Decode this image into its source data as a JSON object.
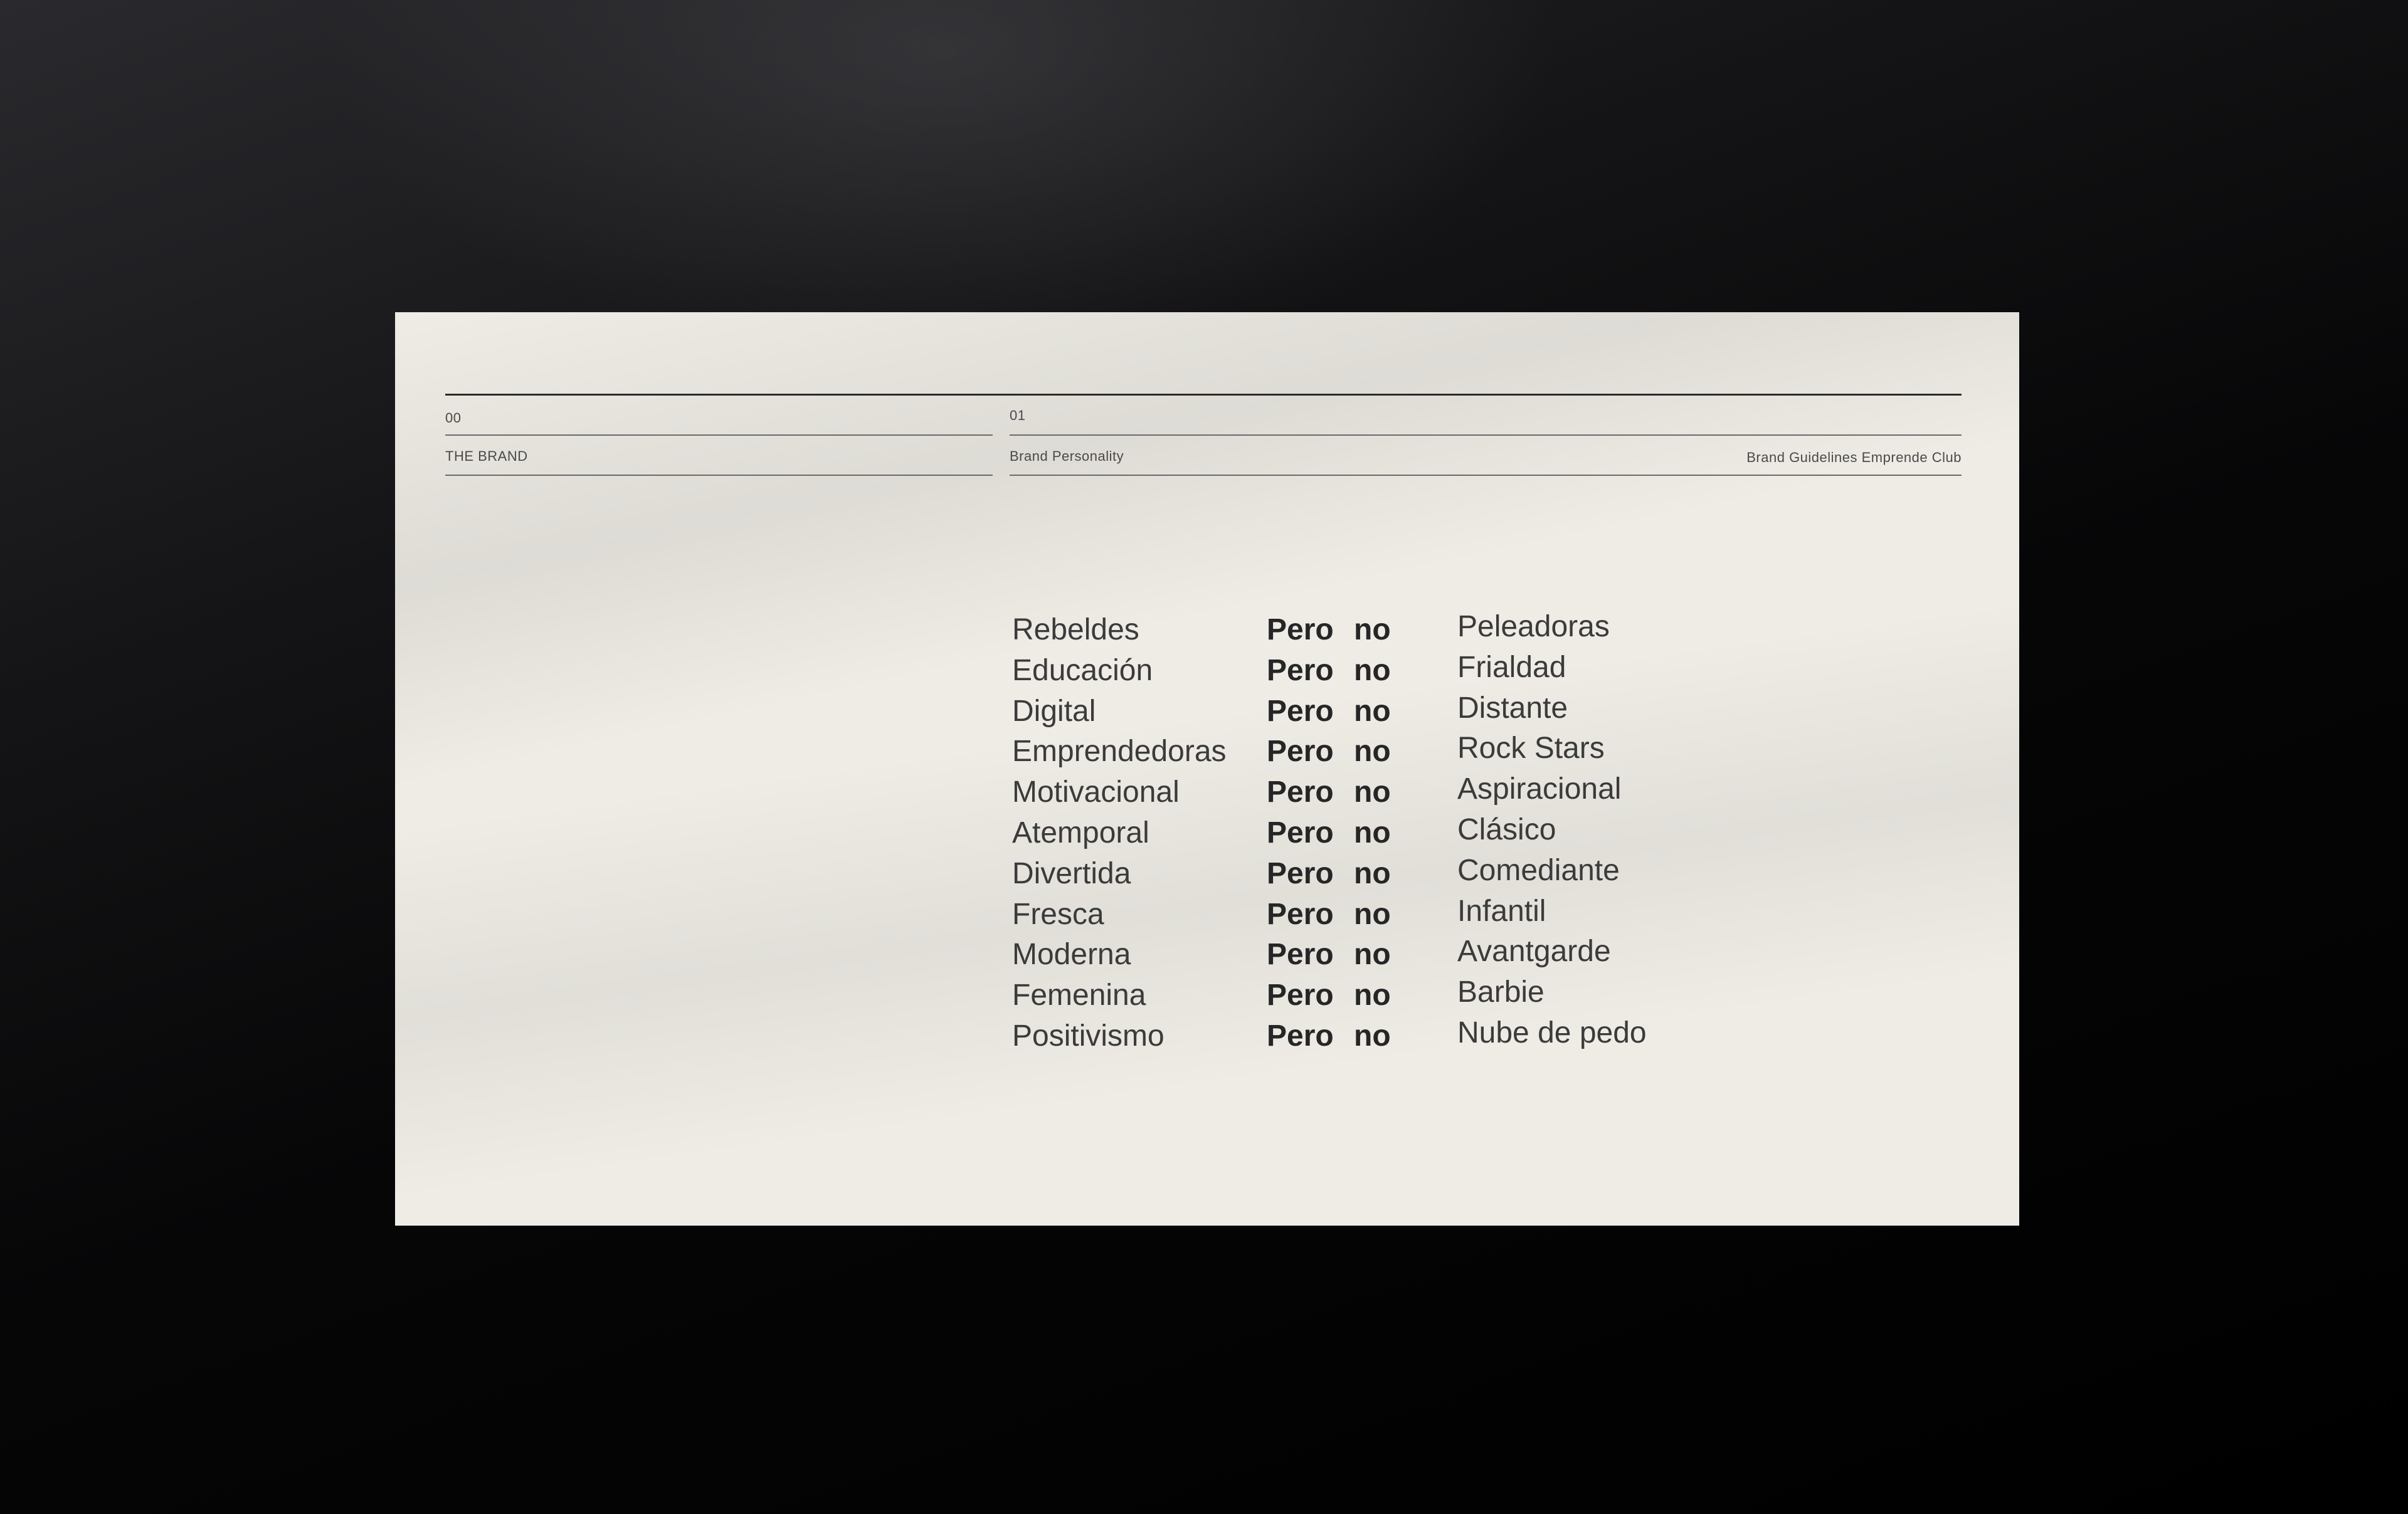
{
  "header": {
    "section_number": "00",
    "section_title": "THE BRAND",
    "page_number": "01",
    "page_title": "Brand Personality",
    "document_title": "Brand Guidelines Emprende Club"
  },
  "personality": {
    "rows": [
      {
        "trait": "Rebeldes",
        "connector": "Pero",
        "negation": "no",
        "antitrait": "Peleadoras"
      },
      {
        "trait": "Educación",
        "connector": "Pero",
        "negation": "no",
        "antitrait": "Frialdad"
      },
      {
        "trait": "Digital",
        "connector": "Pero",
        "negation": "no",
        "antitrait": "Distante"
      },
      {
        "trait": "Emprendedoras",
        "connector": "Pero",
        "negation": "no",
        "antitrait": "Rock Stars"
      },
      {
        "trait": "Motivacional",
        "connector": "Pero",
        "negation": "no",
        "antitrait": "Aspiracional"
      },
      {
        "trait": "Atemporal",
        "connector": "Pero",
        "negation": "no",
        "antitrait": "Clásico"
      },
      {
        "trait": "Divertida",
        "connector": "Pero",
        "negation": "no",
        "antitrait": "Comediante"
      },
      {
        "trait": "Fresca",
        "connector": "Pero",
        "negation": "no",
        "antitrait": "Infantil"
      },
      {
        "trait": "Moderna",
        "connector": "Pero",
        "negation": "no",
        "antitrait": "Avantgarde"
      },
      {
        "trait": "Femenina",
        "connector": "Pero",
        "negation": "no",
        "antitrait": "Barbie"
      },
      {
        "trait": "Positivismo",
        "connector": "Pero",
        "negation": "no",
        "antitrait": "Nube de pedo"
      }
    ]
  },
  "colors": {
    "page_background": "#050506",
    "card_background": "#efece6",
    "text": "#3b3b3b",
    "bold_text": "#262626"
  }
}
